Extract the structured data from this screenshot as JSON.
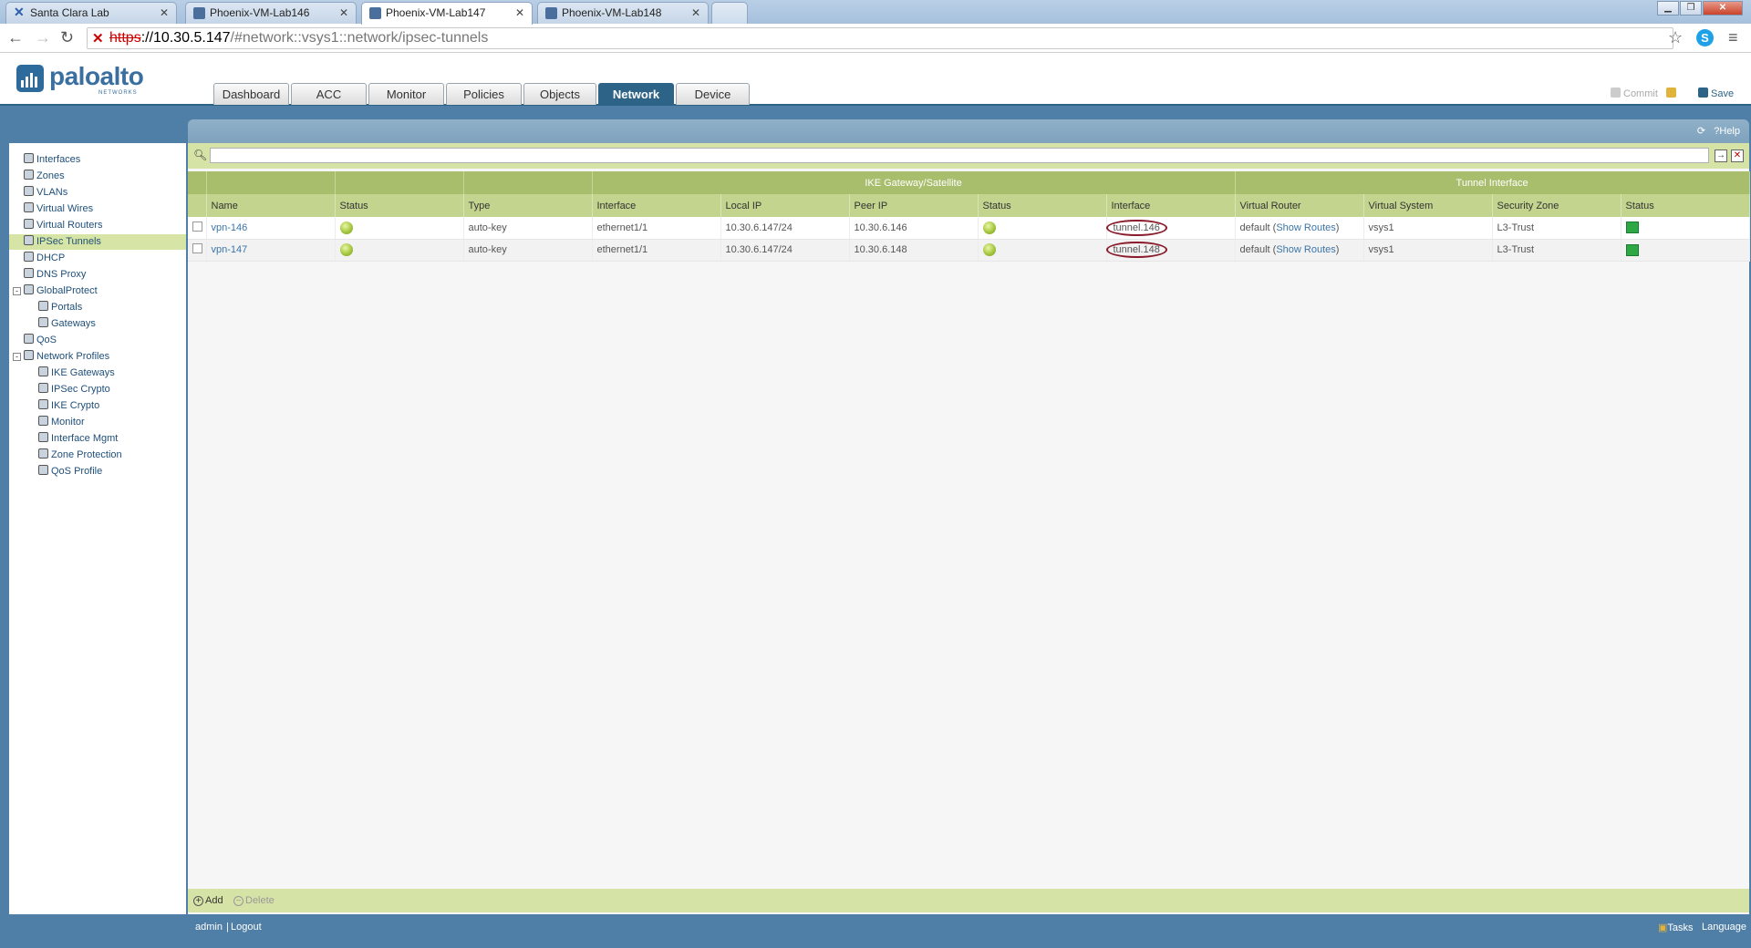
{
  "browser": {
    "tabs": [
      {
        "label": "Santa Clara Lab",
        "active": false
      },
      {
        "label": "Phoenix-VM-Lab146",
        "active": false
      },
      {
        "label": "Phoenix-VM-Lab147",
        "active": true
      },
      {
        "label": "Phoenix-VM-Lab148",
        "active": false
      }
    ],
    "url": {
      "scheme": "https",
      "host": "://10.30.5.147",
      "path": "/#network::vsys1::network/ipsec-tunnels"
    }
  },
  "brand": {
    "name": "paloalto",
    "sub": "NETWORKS"
  },
  "nav_tabs": [
    "Dashboard",
    "ACC",
    "Monitor",
    "Policies",
    "Objects",
    "Network",
    "Device"
  ],
  "active_nav": "Network",
  "header_actions": {
    "commit": "Commit",
    "save": "Save"
  },
  "panel_actions": {
    "help": "Help"
  },
  "sidebar": [
    {
      "label": "Interfaces",
      "icon": "interfaces-icon"
    },
    {
      "label": "Zones",
      "icon": "zones-icon"
    },
    {
      "label": "VLANs",
      "icon": "vlans-icon"
    },
    {
      "label": "Virtual Wires",
      "icon": "virtual-wires-icon"
    },
    {
      "label": "Virtual Routers",
      "icon": "virtual-routers-icon"
    },
    {
      "label": "IPSec Tunnels",
      "icon": "ipsec-tunnels-icon",
      "selected": true
    },
    {
      "label": "DHCP",
      "icon": "dhcp-icon"
    },
    {
      "label": "DNS Proxy",
      "icon": "dns-proxy-icon"
    },
    {
      "label": "GlobalProtect",
      "icon": "globalprotect-icon",
      "expander": "-"
    },
    {
      "label": "Portals",
      "icon": "portals-icon",
      "child": true
    },
    {
      "label": "Gateways",
      "icon": "gateways-icon",
      "child": true
    },
    {
      "label": "QoS",
      "icon": "qos-icon"
    },
    {
      "label": "Network Profiles",
      "icon": "network-profiles-icon",
      "expander": "-"
    },
    {
      "label": "IKE Gateways",
      "icon": "ike-gateways-icon",
      "child": true
    },
    {
      "label": "IPSec Crypto",
      "icon": "ipsec-crypto-icon",
      "child": true
    },
    {
      "label": "IKE Crypto",
      "icon": "ike-crypto-icon",
      "child": true
    },
    {
      "label": "Monitor",
      "icon": "monitor-icon",
      "child": true
    },
    {
      "label": "Interface Mgmt",
      "icon": "interface-mgmt-icon",
      "child": true
    },
    {
      "label": "Zone Protection",
      "icon": "zone-protection-icon",
      "child": true
    },
    {
      "label": "QoS Profile",
      "icon": "qos-profile-icon",
      "child": true
    }
  ],
  "table": {
    "groups": {
      "ike": "IKE Gateway/Satellite",
      "tunnel": "Tunnel Interface"
    },
    "columns": [
      "Name",
      "Status",
      "Type",
      "Interface",
      "Local IP",
      "Peer IP",
      "Status",
      "Interface",
      "Virtual Router",
      "Virtual System",
      "Security Zone",
      "Status"
    ],
    "rows": [
      {
        "name": "vpn-146",
        "type": "auto-key",
        "ike_interface": "ethernet1/1",
        "local_ip": "10.30.6.147/24",
        "peer_ip": "10.30.6.146",
        "tunnel_interface": "tunnel.146",
        "virtual_router": "default",
        "show_routes": "Show Routes",
        "virtual_system": "vsys1",
        "security_zone": "L3-Trust"
      },
      {
        "name": "vpn-147",
        "type": "auto-key",
        "ike_interface": "ethernet1/1",
        "local_ip": "10.30.6.147/24",
        "peer_ip": "10.30.6.148",
        "tunnel_interface": "tunnel.148",
        "virtual_router": "default",
        "show_routes": "Show Routes",
        "virtual_system": "vsys1",
        "security_zone": "L3-Trust"
      }
    ]
  },
  "bottom_actions": {
    "add": "Add",
    "delete": "Delete"
  },
  "status_bar": {
    "user": "admin",
    "logout": "Logout",
    "tasks": "Tasks",
    "language": "Language"
  },
  "colors": {
    "accent": "#2d6387",
    "status_ok": "#9fc23a",
    "tunnel_up": "#2ea845",
    "highlight_ring": "#8b1a2a"
  }
}
